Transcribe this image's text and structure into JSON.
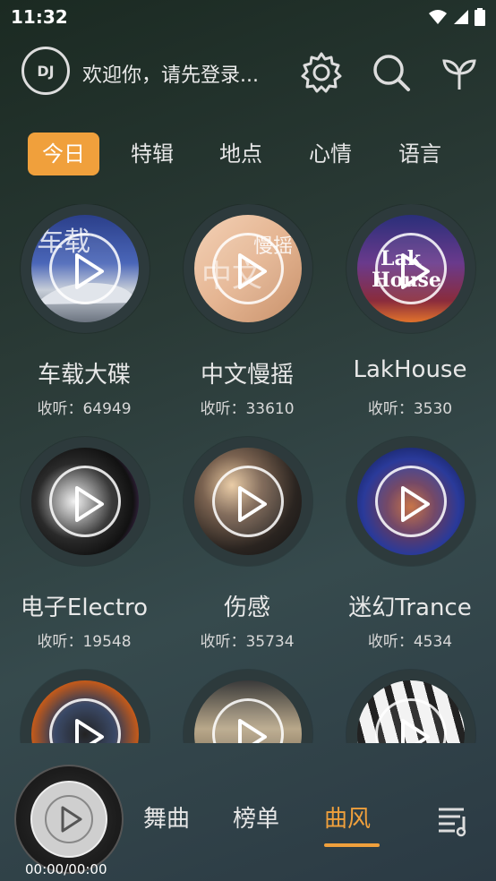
{
  "status": {
    "time": "11:32"
  },
  "header": {
    "logo_text": "DJ",
    "welcome": "欢迎你，请先登录..."
  },
  "tabs": [
    {
      "label": "今日",
      "active": true
    },
    {
      "label": "特辑",
      "active": false
    },
    {
      "label": "地点",
      "active": false
    },
    {
      "label": "心情",
      "active": false
    },
    {
      "label": "语言",
      "active": false
    }
  ],
  "cards": [
    {
      "title": "车载大碟",
      "count": "收听：64949"
    },
    {
      "title": "中文慢摇",
      "count": "收听：33610"
    },
    {
      "title": "LakHouse",
      "count": "收听：3530"
    },
    {
      "title": "电子Electro",
      "count": "收听：19548"
    },
    {
      "title": "伤感",
      "count": "收听：35734"
    },
    {
      "title": "迷幻Trance",
      "count": "收听：4534"
    },
    {
      "title": "",
      "count": ""
    },
    {
      "title": "",
      "count": ""
    },
    {
      "title": "",
      "count": ""
    }
  ],
  "player": {
    "time": "00:00/00:00"
  },
  "nav": [
    {
      "label": "舞曲",
      "active": false
    },
    {
      "label": "榜单",
      "active": false
    },
    {
      "label": "曲风",
      "active": true
    }
  ],
  "colors": {
    "accent": "#f0a03c"
  }
}
